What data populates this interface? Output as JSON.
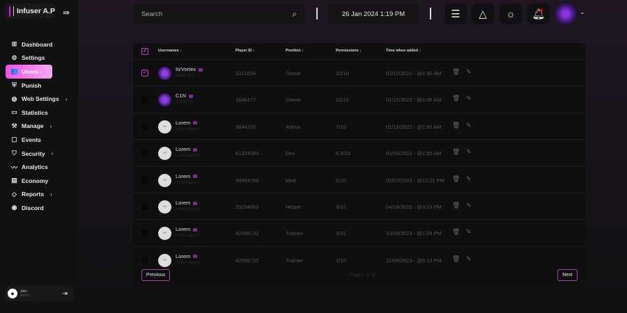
{
  "brand": {
    "name": "Infuser A.P",
    "accent": "#d020d8"
  },
  "sidebar": {
    "items": [
      {
        "label": "Dashboard",
        "icon": "dashboard-icon",
        "glyph": "⊞"
      },
      {
        "label": "Settings",
        "icon": "gear-icon",
        "glyph": "⚙"
      },
      {
        "label": "Users -",
        "icon": "users-icon",
        "glyph": "👥",
        "active": true
      },
      {
        "label": "Punish",
        "icon": "shield-icon",
        "glyph": "⛨"
      },
      {
        "label": "Web Settings",
        "icon": "globe-icon",
        "glyph": "◍",
        "chevron": true
      },
      {
        "label": "Statistics",
        "icon": "wallet-icon",
        "glyph": "▭"
      },
      {
        "label": "Manage",
        "icon": "hammer-icon",
        "glyph": "⚒",
        "chevron": true
      },
      {
        "label": "Events",
        "icon": "calendar-icon",
        "glyph": "▢"
      },
      {
        "label": "Security",
        "icon": "shield-check-icon",
        "glyph": "⛉",
        "chevron": true
      },
      {
        "label": "Analytics",
        "icon": "analytics-icon",
        "glyph": "〰"
      },
      {
        "label": "Economy",
        "icon": "newspaper-icon",
        "glyph": "▤"
      },
      {
        "label": "Reports",
        "icon": "ticket-icon",
        "glyph": "◇",
        "chevron": true
      },
      {
        "label": "Discord",
        "icon": "discord-icon",
        "glyph": "◉"
      }
    ]
  },
  "user": {
    "name": "Join-",
    "role": "Admin"
  },
  "header": {
    "search_placeholder": "Search",
    "datetime": "26 Jan 2024 1:19 PM"
  },
  "table": {
    "columns": [
      "Usernames",
      "Player ID",
      "Position",
      "Permissions",
      "Time when added"
    ],
    "rows": [
      {
        "name": "ItzVortex",
        "sub": "Stack Ste...",
        "id": "1321654",
        "position": "Owner",
        "perms": "10/10",
        "time": "01/10/2022 - @1:30 AM",
        "checked": true,
        "avatar": "custom"
      },
      {
        "name": "C1N",
        "sub": "CnCnCnn",
        "id": "1646477",
        "position": "Owner",
        "perms": "10/10",
        "time": "01/15/2022 - @2:06 AM",
        "checked": false,
        "avatar": "custom"
      },
      {
        "name": "Lorem",
        "sub": "Lorem Ipsum",
        "id": "9844200",
        "position": "Admin",
        "perms": "7/10",
        "time": "01/16/2022 - @1:50 AM",
        "checked": false,
        "avatar": "discord"
      },
      {
        "name": "Lorem",
        "sub": "Lorem Ipsum",
        "id": "61324080",
        "position": "Dev",
        "perms": "6.5/10",
        "time": "01/26/2022 - @2:55 AM",
        "checked": false,
        "avatar": "discord"
      },
      {
        "name": "Lorem",
        "sub": "Lorem Ipsum",
        "id": "56654789",
        "position": "Mod",
        "perms": "5/10",
        "time": "02/07/2023 - @12:21 PM",
        "checked": false,
        "avatar": "discord"
      },
      {
        "name": "Lorem",
        "sub": "Lorem Ipsum",
        "id": "23154683",
        "position": "Helper",
        "perms": "3/10",
        "time": "04/18/2023 - @3:13 PM",
        "checked": false,
        "avatar": "discord"
      },
      {
        "name": "Lorem",
        "sub": "Lorem Ipsum",
        "id": "42068732",
        "position": "Trainee",
        "perms": "2/10",
        "time": "10/29/2023 - @1:08 PM",
        "checked": false,
        "avatar": "discord"
      },
      {
        "name": "Lorem",
        "sub": "Lorem Ipsum",
        "id": "42068732",
        "position": "Trainee",
        "perms": "2/10",
        "time": "12/09/2023 - @6:10 PM",
        "checked": false,
        "avatar": "discord"
      }
    ]
  },
  "pagination": {
    "previous": "Previous",
    "next": "Next",
    "info": "Page 1 of 10"
  }
}
